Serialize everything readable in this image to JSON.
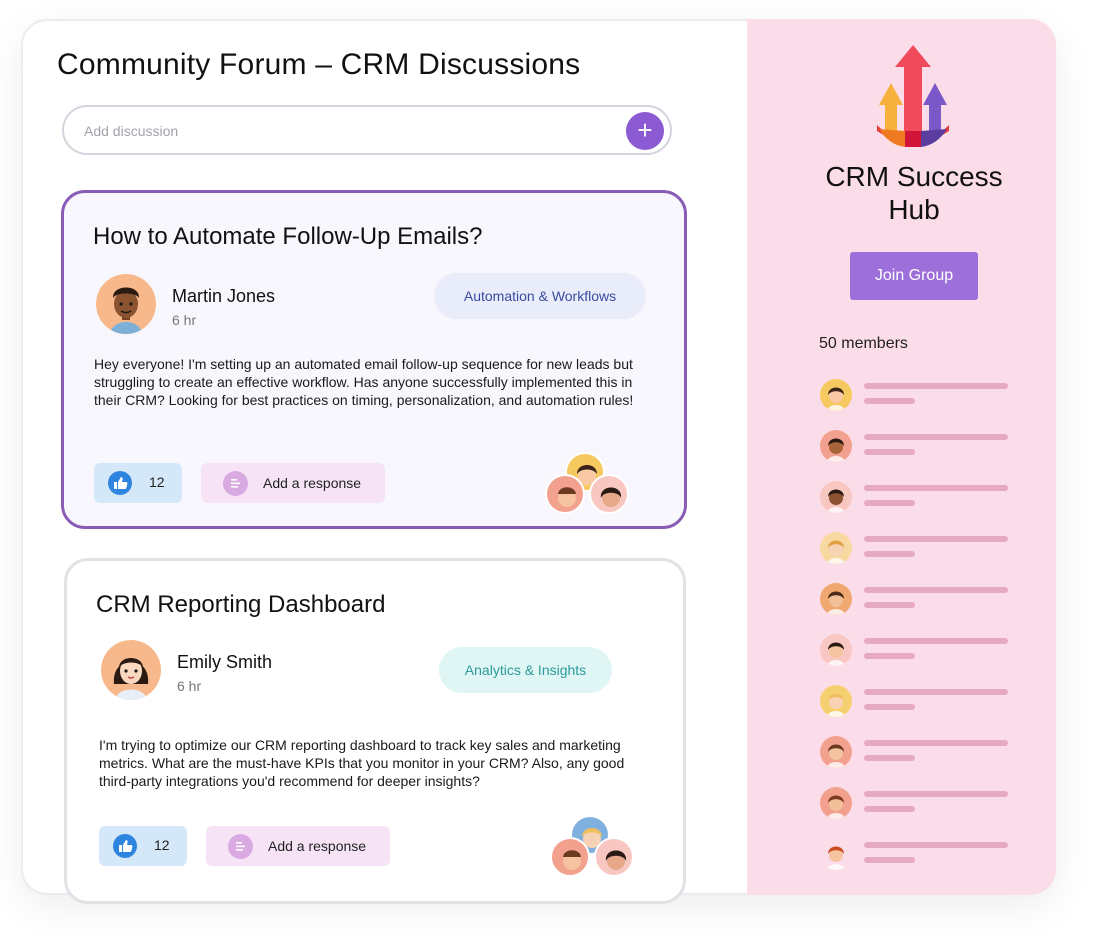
{
  "page": {
    "title": "Community Forum – CRM Discussions",
    "search_placeholder": "Add discussion",
    "add_button": "+"
  },
  "posts": [
    {
      "title": "How to Automate Follow-Up Emails?",
      "author": "Martin Jones",
      "time": "6 hr",
      "tag": "Automation & Workflows",
      "body": "Hey everyone! I'm setting up an automated email follow-up sequence for new leads but struggling to create an effective workflow. Has anyone successfully implemented this in their CRM? Looking for best practices on timing, personalization, and automation rules!",
      "likes": "12",
      "reply_label": "Add a response"
    },
    {
      "title": "CRM Reporting Dashboard",
      "author": "Emily Smith",
      "time": "6 hr",
      "tag": "Analytics & Insights",
      "body": "I'm trying to optimize our CRM reporting dashboard to track key sales and marketing metrics. What are the must-have KPIs that you monitor in your CRM? Also, any good third-party integrations you'd recommend for deeper insights?",
      "likes": "12",
      "reply_label": "Add a response"
    }
  ],
  "sidebar": {
    "group_title": "CRM Success Hub",
    "join_label": "Join Group",
    "members_label": "50 members"
  },
  "colors": {
    "accent": "#8c5ad2",
    "sidebar_bg": "#fbdde9",
    "tag_automation_bg": "#e9edfa",
    "tag_automation_text": "#3b4aa0",
    "tag_analytics_bg": "#e0f6f5",
    "tag_analytics_text": "#2b9a9a"
  }
}
